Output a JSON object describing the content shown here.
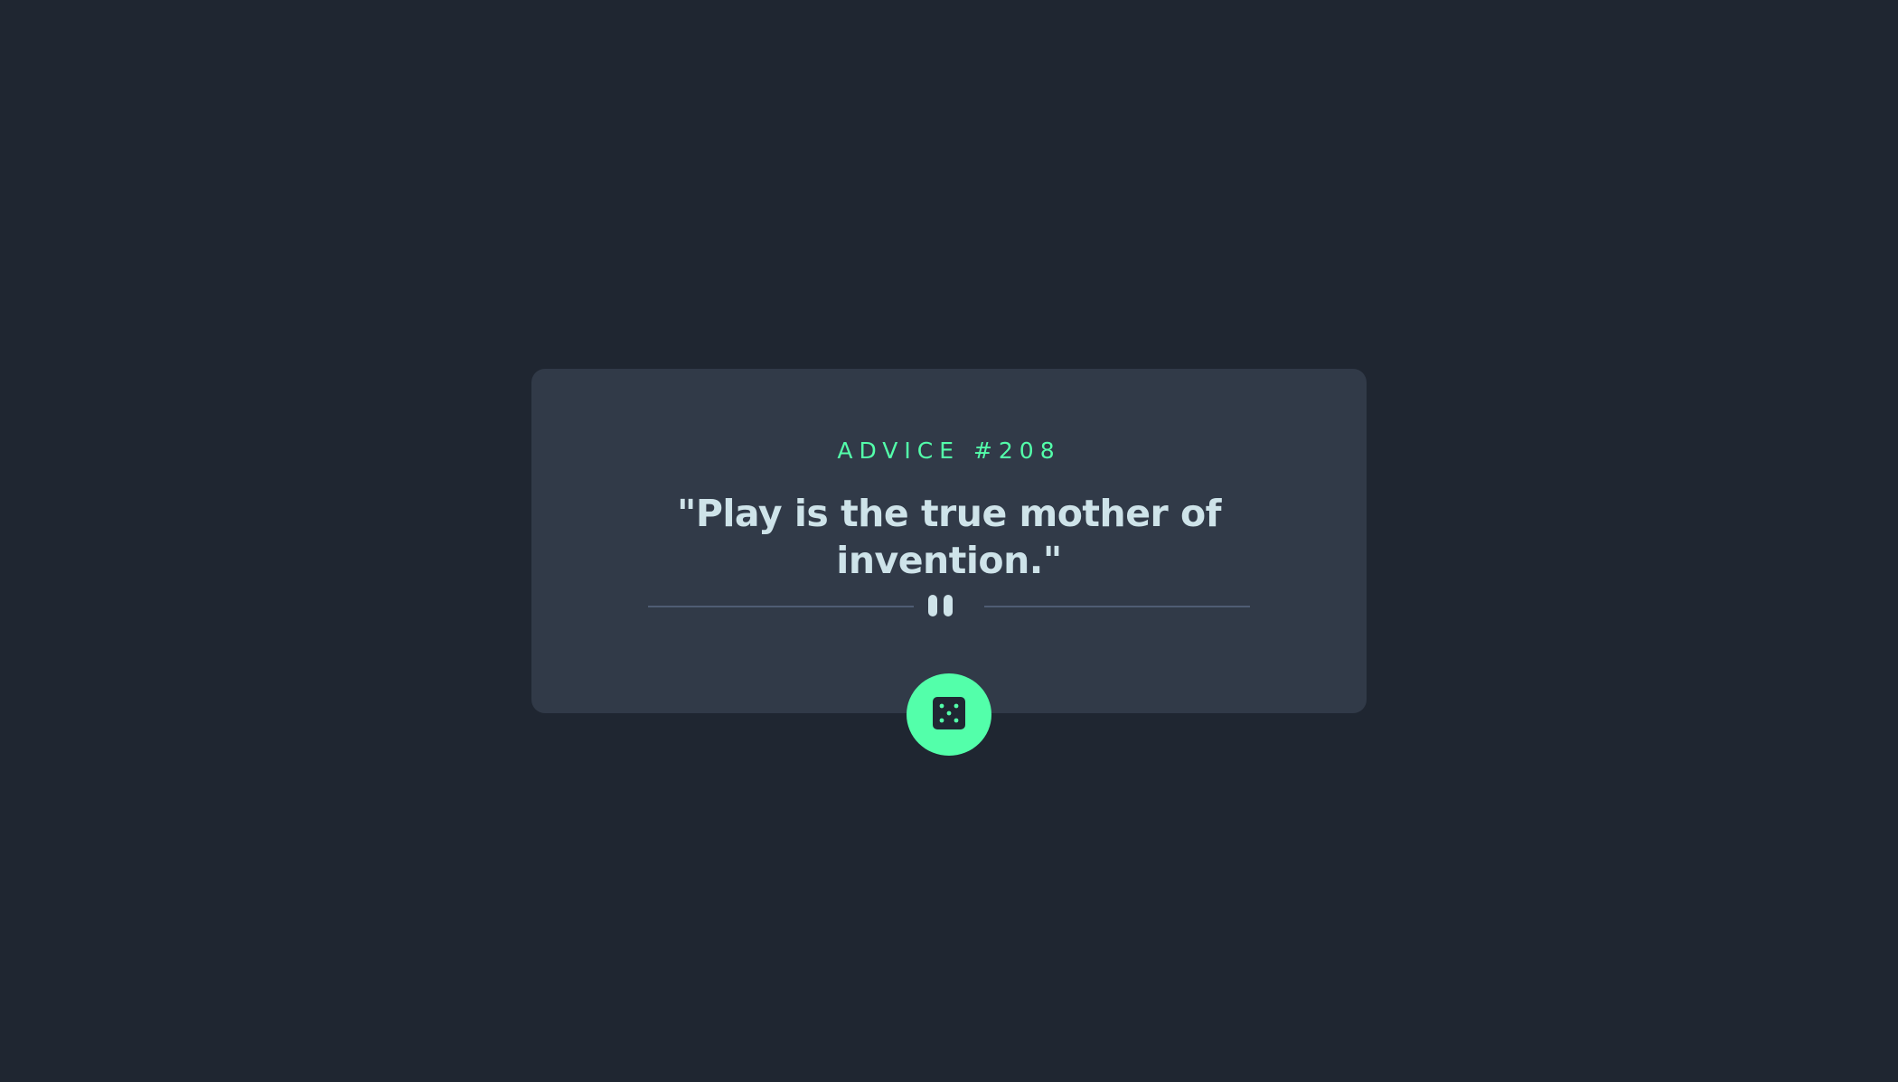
{
  "advice": {
    "label": "ADVICE #208",
    "text": "\"Play is the true mother of invention.\""
  },
  "divider": {
    "icon": "pause-icon"
  },
  "button": {
    "icon": "dice-icon",
    "aria_label": "Get new advice"
  },
  "colors": {
    "background": "#1f2631",
    "card": "#313a48",
    "accent": "#53ffaa",
    "text": "#cee3e9",
    "divider": "#4f5d74"
  }
}
